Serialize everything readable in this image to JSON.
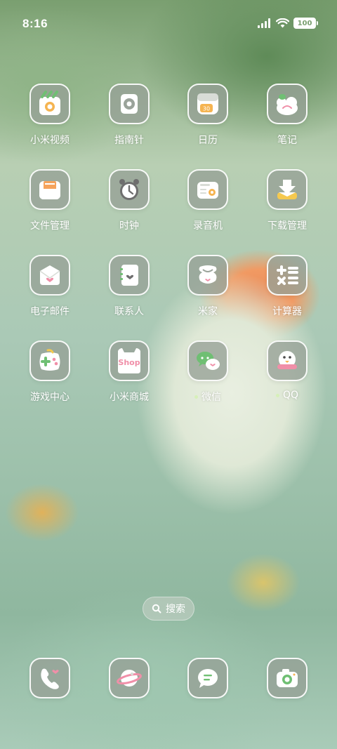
{
  "status": {
    "time": "8:16",
    "battery": "100"
  },
  "apps": [
    {
      "label": "小米视频",
      "icon": "video-icon"
    },
    {
      "label": "指南针",
      "icon": "compass-icon"
    },
    {
      "label": "日历",
      "icon": "calendar-icon",
      "badge": "30"
    },
    {
      "label": "笔记",
      "icon": "notes-icon"
    },
    {
      "label": "文件管理",
      "icon": "folder-icon"
    },
    {
      "label": "时钟",
      "icon": "clock-icon"
    },
    {
      "label": "录音机",
      "icon": "recorder-icon"
    },
    {
      "label": "下载管理",
      "icon": "download-icon"
    },
    {
      "label": "电子邮件",
      "icon": "mail-icon"
    },
    {
      "label": "联系人",
      "icon": "contacts-icon"
    },
    {
      "label": "米家",
      "icon": "mihome-icon"
    },
    {
      "label": "计算器",
      "icon": "calculator-icon"
    },
    {
      "label": "游戏中心",
      "icon": "gamepad-icon"
    },
    {
      "label": "小米商城",
      "icon": "shop-icon",
      "badge": "Shop"
    },
    {
      "label": "微信",
      "icon": "wechat-icon",
      "new_dot": true
    },
    {
      "label": "QQ",
      "icon": "qq-icon",
      "new_dot": true
    }
  ],
  "search": {
    "label": "搜索"
  },
  "dock": [
    {
      "icon": "phone-icon"
    },
    {
      "icon": "browser-icon"
    },
    {
      "icon": "messages-icon"
    },
    {
      "icon": "camera-icon"
    }
  ]
}
